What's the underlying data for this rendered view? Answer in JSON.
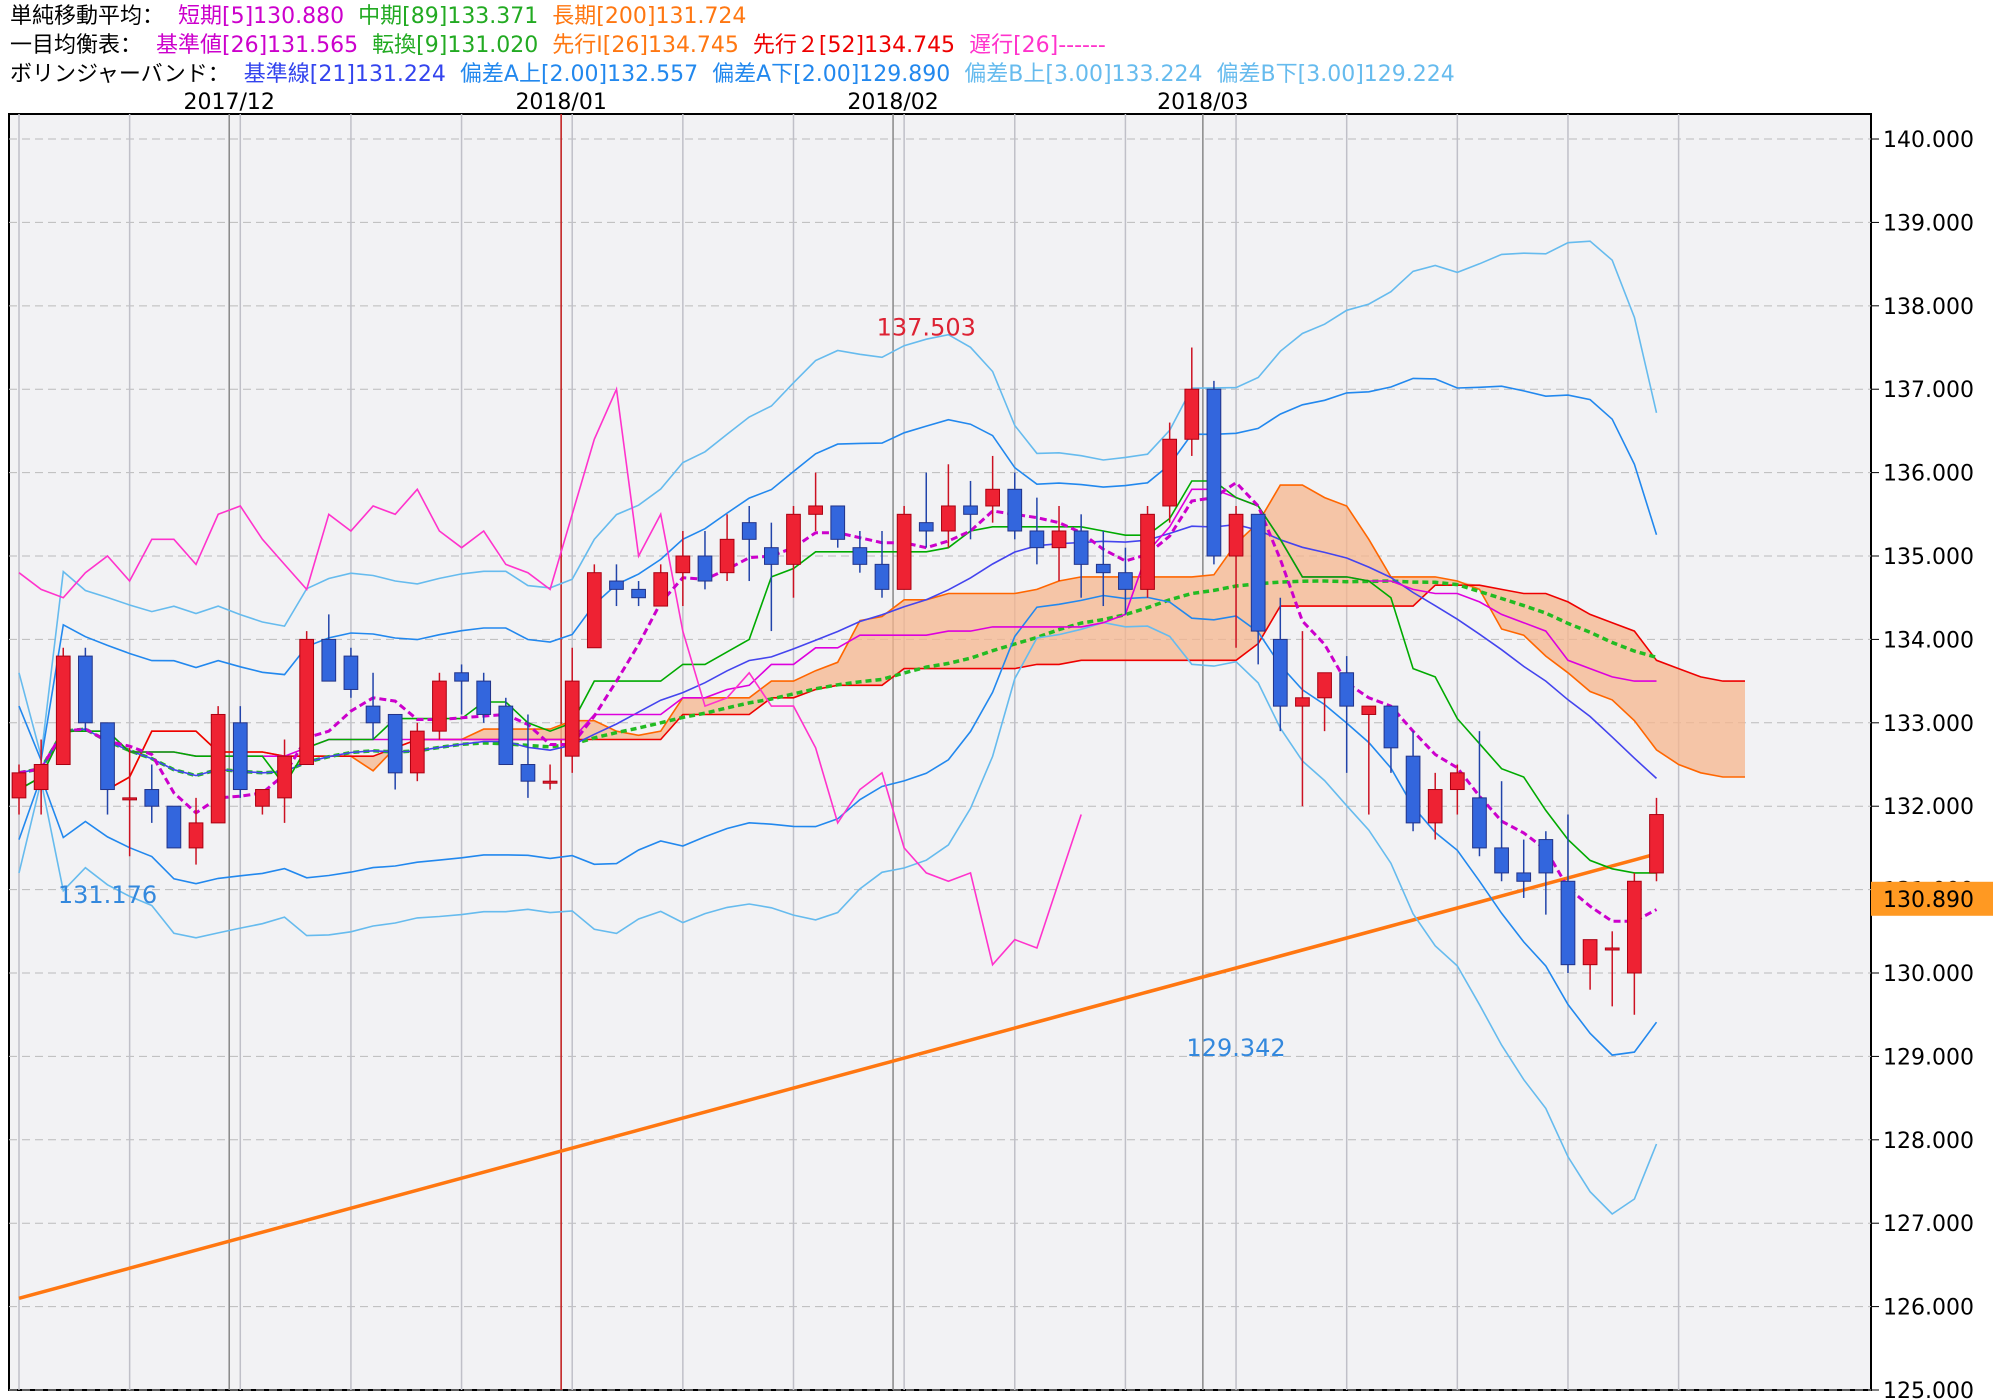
{
  "legend": {
    "ma_title": "単純移動平均：",
    "ma_short": "短期[5]130.880",
    "ma_mid": "中期[89]133.371",
    "ma_long": "長期[200]131.724",
    "ichimoku_title": "一目均衡表：",
    "kijun": "基準値[26]131.565",
    "tenkan": "転換[9]131.020",
    "senko1": "先行Ⅰ[26]134.745",
    "senko2": "先行２[52]134.745",
    "chikou": "遅行[26]------",
    "bb_title": "ボリンジャーバンド：",
    "bb_mid": "基準線[21]131.224",
    "bb_a_up": "偏差A上[2.00]132.557",
    "bb_a_dn": "偏差A下[2.00]129.890",
    "bb_b_up": "偏差B上[3.00]133.224",
    "bb_b_dn": "偏差B下[3.00]129.224"
  },
  "colors": {
    "up": "#ee2233",
    "down": "#3366dd",
    "ma_short": "#cc00cc",
    "ma_mid": "#22bb22",
    "ma_long": "#ff7711",
    "kijun": "#dd00dd",
    "tenkan": "#00aa00",
    "senko1": "#ff6600",
    "senko2": "#ee0000",
    "chikou": "#ff33cc",
    "bb_mid": "#4444ee",
    "bb_a": "#2288ee",
    "bb_b": "#66bbee"
  },
  "chart_data": {
    "type": "candlestick",
    "ylim": [
      125,
      140.3
    ],
    "y_ticks": [
      "140.000",
      "139.000",
      "138.000",
      "137.000",
      "136.000",
      "135.000",
      "134.000",
      "133.000",
      "132.000",
      "131.000",
      "130.000",
      "129.000",
      "128.000",
      "127.000",
      "126.000",
      "125.000"
    ],
    "month_labels": [
      {
        "i": 10,
        "text": "2017/12"
      },
      {
        "i": 25,
        "text": "2018/01"
      },
      {
        "i": 40,
        "text": "2018/02"
      },
      {
        "i": 54,
        "text": "2018/03"
      }
    ],
    "current_price": "130.890",
    "high_label": {
      "i": 41,
      "price": 137.503,
      "text": "137.503"
    },
    "low_labels": [
      {
        "i": 4,
        "price": 131.176,
        "text": "131.176"
      },
      {
        "i": 55,
        "price": 129.342,
        "text": "129.342"
      }
    ],
    "ohlc": [
      [
        132.1,
        132.5,
        131.9,
        132.4
      ],
      [
        132.2,
        132.8,
        131.9,
        132.5
      ],
      [
        132.5,
        133.9,
        132.5,
        133.8
      ],
      [
        133.8,
        133.9,
        132.9,
        133.0
      ],
      [
        133.0,
        133.0,
        131.9,
        132.2
      ],
      [
        132.1,
        132.7,
        131.4,
        132.1
      ],
      [
        132.2,
        132.5,
        131.8,
        132.0
      ],
      [
        132.0,
        132.0,
        131.5,
        131.5
      ],
      [
        131.5,
        132.1,
        131.3,
        131.8
      ],
      [
        131.8,
        133.2,
        131.8,
        133.1
      ],
      [
        133.0,
        133.2,
        132.1,
        132.2
      ],
      [
        132.0,
        132.2,
        131.9,
        132.2
      ],
      [
        132.1,
        132.8,
        131.8,
        132.6
      ],
      [
        132.5,
        134.1,
        132.5,
        134.0
      ],
      [
        134.0,
        134.3,
        133.5,
        133.5
      ],
      [
        133.8,
        133.9,
        133.3,
        133.4
      ],
      [
        133.2,
        133.6,
        132.8,
        133.0
      ],
      [
        133.1,
        133.1,
        132.2,
        132.4
      ],
      [
        132.4,
        133.0,
        132.3,
        132.9
      ],
      [
        132.9,
        133.6,
        132.8,
        133.5
      ],
      [
        133.6,
        133.7,
        133.1,
        133.5
      ],
      [
        133.5,
        133.6,
        133.0,
        133.1
      ],
      [
        133.2,
        133.3,
        132.5,
        132.5
      ],
      [
        132.5,
        133.1,
        132.1,
        132.3
      ],
      [
        132.3,
        132.5,
        132.2,
        132.3
      ],
      [
        132.6,
        133.9,
        132.4,
        133.5
      ],
      [
        133.9,
        134.9,
        133.9,
        134.8
      ],
      [
        134.7,
        134.9,
        134.4,
        134.6
      ],
      [
        134.6,
        134.7,
        134.4,
        134.5
      ],
      [
        134.4,
        134.9,
        134.4,
        134.8
      ],
      [
        134.8,
        135.3,
        134.4,
        135.0
      ],
      [
        135.0,
        135.3,
        134.6,
        134.7
      ],
      [
        134.8,
        135.5,
        134.7,
        135.2
      ],
      [
        135.4,
        135.6,
        134.7,
        135.2
      ],
      [
        135.1,
        135.4,
        134.1,
        134.9
      ],
      [
        134.9,
        135.6,
        134.5,
        135.5
      ],
      [
        135.5,
        136.0,
        135.3,
        135.6
      ],
      [
        135.6,
        135.6,
        135.1,
        135.2
      ],
      [
        135.1,
        135.3,
        134.8,
        134.9
      ],
      [
        134.9,
        135.3,
        134.5,
        134.6
      ],
      [
        134.6,
        135.6,
        134.6,
        135.5
      ],
      [
        135.4,
        136.0,
        135.1,
        135.3
      ],
      [
        135.3,
        136.1,
        135.1,
        135.6
      ],
      [
        135.6,
        135.9,
        135.2,
        135.5
      ],
      [
        135.6,
        136.2,
        135.4,
        135.8
      ],
      [
        135.8,
        136.0,
        135.2,
        135.3
      ],
      [
        135.3,
        135.7,
        134.9,
        135.1
      ],
      [
        135.1,
        135.6,
        134.7,
        135.3
      ],
      [
        135.3,
        135.5,
        134.5,
        134.9
      ],
      [
        134.9,
        135.3,
        134.4,
        134.8
      ],
      [
        134.8,
        135.1,
        134.3,
        134.6
      ],
      [
        134.6,
        135.6,
        134.5,
        135.5
      ],
      [
        135.6,
        136.6,
        135.4,
        136.4
      ],
      [
        136.4,
        137.5,
        136.2,
        137.0
      ],
      [
        137.0,
        137.1,
        134.9,
        135.0
      ],
      [
        135.0,
        135.6,
        133.9,
        135.5
      ],
      [
        135.5,
        135.5,
        133.7,
        134.1
      ],
      [
        134.0,
        134.5,
        132.9,
        133.2
      ],
      [
        133.2,
        134.1,
        132.0,
        133.3
      ],
      [
        133.3,
        133.6,
        132.9,
        133.6
      ],
      [
        133.6,
        133.8,
        132.4,
        133.2
      ],
      [
        133.1,
        133.2,
        131.9,
        133.2
      ],
      [
        133.2,
        133.2,
        132.4,
        132.7
      ],
      [
        132.6,
        132.9,
        131.7,
        131.8
      ],
      [
        131.8,
        132.4,
        131.6,
        132.2
      ],
      [
        132.2,
        132.5,
        131.9,
        132.4
      ],
      [
        132.1,
        132.9,
        131.4,
        131.5
      ],
      [
        131.5,
        132.3,
        131.1,
        131.2
      ],
      [
        131.2,
        131.6,
        130.9,
        131.1
      ],
      [
        131.6,
        131.7,
        130.7,
        131.2
      ],
      [
        131.1,
        131.9,
        130.0,
        130.1
      ],
      [
        130.1,
        130.4,
        129.8,
        130.4
      ],
      [
        130.3,
        130.5,
        129.6,
        130.3
      ],
      [
        130.0,
        131.2,
        129.5,
        131.1
      ],
      [
        131.2,
        132.1,
        131.1,
        131.9
      ]
    ]
  }
}
